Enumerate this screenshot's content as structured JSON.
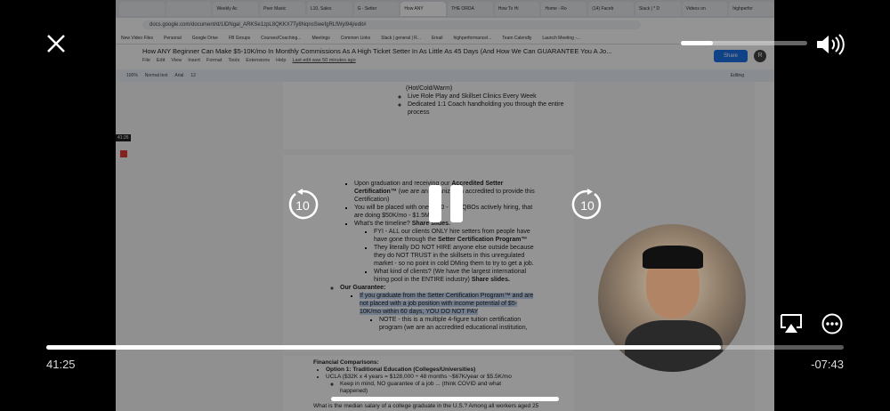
{
  "browser": {
    "tabs": [
      "",
      "",
      "Weekly Ac",
      "Peer Mastc",
      "L10, Sales",
      "G - Setter",
      "How ANY",
      "THE ORDA",
      "How To Hi",
      "Home - Ro",
      "(14) Faceb",
      "Slack | * D",
      "Videos on",
      "highperfor"
    ],
    "url": "docs.google.com/document/d/1IDNgal_ARKSe1zpL8QKKX7Ty8NqnsSwefgRLfWyl94j/edit#",
    "bookmarks": [
      "New Video Files",
      "Personal",
      "Google Drive",
      "FB Groups",
      "Courses/Coaching...",
      "Meetings",
      "Common Links",
      "Slack | general | R...",
      "Email",
      "highperformancel...",
      "Team Calendly",
      "Launch Meeting -..."
    ]
  },
  "doc": {
    "title": "How ANY Beginner Can Make $5-10K/mo In Monthly Commissions As A High Ticket Setter In As Little As 45 Days (And How We Can GUARANTEE You A Jo...",
    "menus": [
      "File",
      "Edit",
      "View",
      "Insert",
      "Format",
      "Tools",
      "Extensions",
      "Help"
    ],
    "last_edit": "Last edit was 50 minutes ago",
    "share": "Share",
    "avatar": "R",
    "toolbar": {
      "zoom": "100%",
      "style": "Normal text",
      "font": "Arial",
      "size": "12",
      "mode": "Editing"
    },
    "page1": [
      "(Hot/Cold/Warm)",
      "Live Role Play and Skillset Clinics Every Week",
      "Dedicated 1:1 Coach handholding you through the entire process"
    ],
    "page2": {
      "b1a": "Upon graduation and receiving our ",
      "b1b": "Accredited Setter Certification™",
      "b1c": " (we are an organization accredited to provide this Certification)",
      "b2": "You will be placed with one of 50 - 100 QBOs actively hiring, that are doing $50K/mo - $1.5M/mo",
      "b3a": "What's the timeline? ",
      "b3b": "Share slides.",
      "s1a": "FYI - ALL our clients ONLY hire setters from people have have gone through the ",
      "s1b": "Setter Certification Program™",
      "s2": "They literally DO NOT HIRE anyone else outside because they do NOT TRUST in the skillsets in this unregulated market - so no point in cold DMing them to try to get a job.",
      "s3a": "What kind of clients? (We have the largest international hiring pool in the ENTIRE industry) ",
      "s3b": "Share slides.",
      "guarantee": "Our Guarantee:",
      "g1": "If you graduate from the Setter Certification Program™ and are not placed with a job position with income potential of $5-10K/mo within 60 days, YOU DO NOT PAY",
      "g2": "NOTE - this is a multiple 4-figure tuition certification program (we are an accredited educational institution,"
    },
    "page3": {
      "heading": "Financial Comparisons:",
      "o1": "Option 1: Traditional Education (Colleges/Universities)",
      "ucla": "UCLA ($32K x 4 years = $128,000 ÷ 48 months ~$67K/year or $5.5K/mo",
      "keep": "Keep in mind, NO guarantee of a job ... (think COVID and what happened)",
      "median": "What is the median salary of a college graduate in the U.S.? Among all workers aged 25"
    },
    "recorder_time": "41:26"
  },
  "player": {
    "elapsed": "41:25",
    "remaining": "-07:43",
    "progress_pct": 84.6,
    "volume_pct": 25,
    "skip_seconds": "10"
  }
}
